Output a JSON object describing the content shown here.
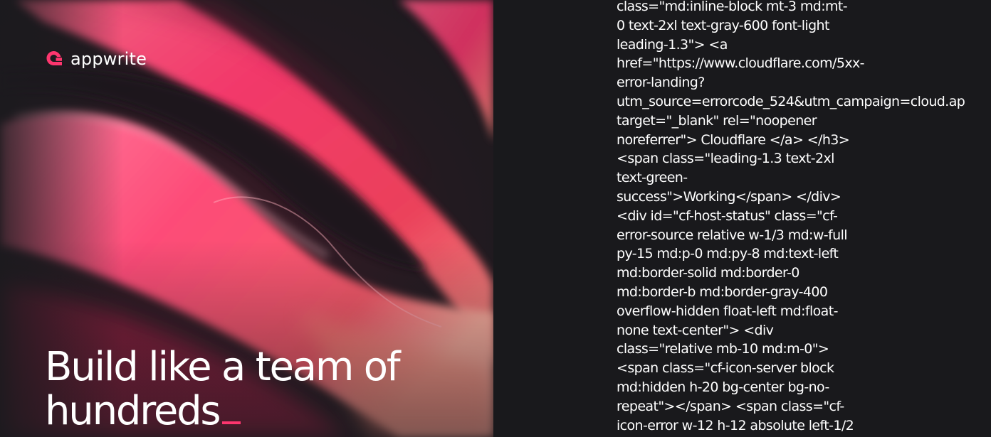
{
  "brand": {
    "name": "appwrite",
    "accent_color": "#fd366e"
  },
  "hero": {
    "headline_line1": "Build like a team of",
    "headline_line2": "hundreds",
    "cursor_char": "_"
  },
  "code_panel": {
    "lines": [
      "class=\"md:inline-block mt-3 md:mt-",
      "0 text-2xl text-gray-600 font-light",
      "leading-1.3\"> <a",
      "href=\"https://www.cloudflare.com/5xx-",
      "error-landing?",
      "utm_source=errorcode_524&utm_campaign=cloud.ap",
      "target=\"_blank\" rel=\"noopener",
      "noreferrer\"> Cloudflare </a> </h3>",
      "<span class=\"leading-1.3 text-2xl",
      "text-green-",
      "success\">Working</span> </div>",
      "<div id=\"cf-host-status\" class=\"cf-",
      "error-source relative w-1/3 md:w-full",
      "py-15 md:p-0 md:py-8 md:text-left",
      "md:border-solid md:border-0",
      "md:border-b md:border-gray-400",
      "overflow-hidden float-left md:float-",
      "none text-center\"> <div",
      "class=\"relative mb-10 md:m-0\">",
      "<span class=\"cf-icon-server block",
      "md:hidden h-20 bg-center bg-no-",
      "repeat\"></span> <span class=\"cf-",
      "icon-error w-12 h-12 absolute left-1/2"
    ]
  }
}
